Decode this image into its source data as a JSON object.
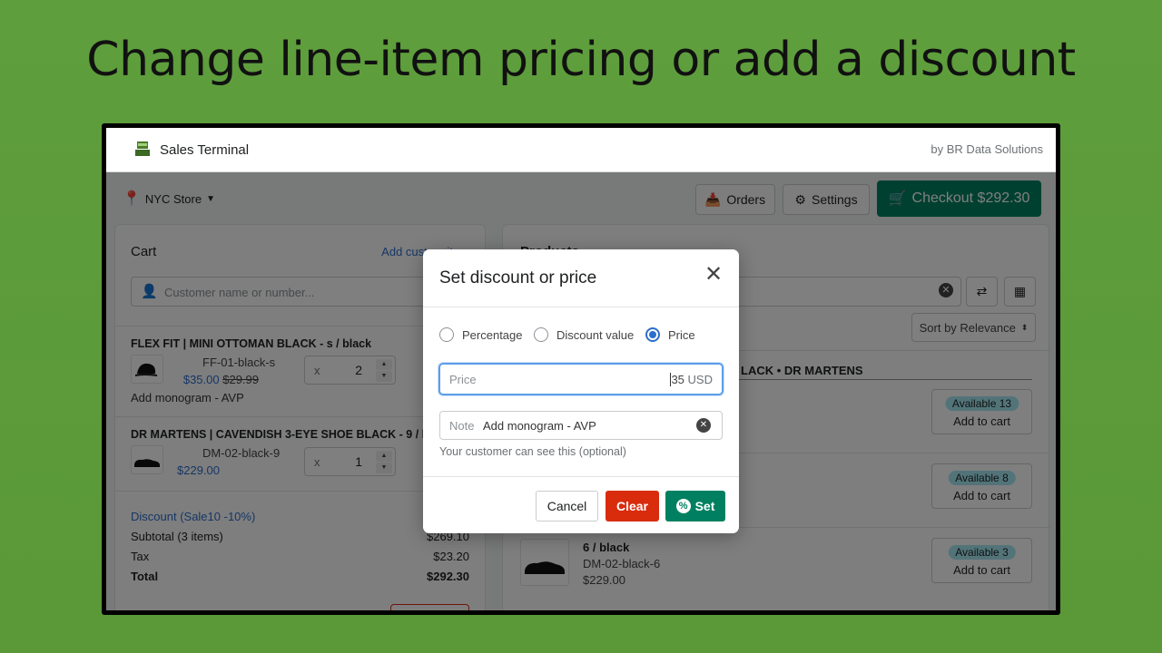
{
  "slide": {
    "title": "Change line-item pricing or add a discount"
  },
  "header": {
    "app_name": "Sales Terminal",
    "vendor": "by BR Data Solutions"
  },
  "toolbar": {
    "store": "NYC Store",
    "orders": "Orders",
    "settings": "Settings",
    "checkout": "Checkout $292.30"
  },
  "cart": {
    "title": "Cart",
    "add_custom_item": "Add custom item",
    "customer_placeholder": "Customer name or number...",
    "items": [
      {
        "title": "FLEX FIT | MINI OTTOMAN BLACK - s / black",
        "sku": "FF-01-black-s",
        "price": "$35.00",
        "original_price": "$29.99",
        "qty": "2",
        "note": "Add monogram - AVP",
        "qty_prefix": "x"
      },
      {
        "title": "DR MARTENS | CAVENDISH 3-EYE SHOE BLACK - 9 / black",
        "sku": "DM-02-black-9",
        "price": "$229.00",
        "qty": "1",
        "qty_prefix": "x"
      }
    ],
    "discount": "Discount (Sale10 -10%)",
    "subtotal_label": "Subtotal (3 items)",
    "subtotal": "$269.10",
    "tax_label": "Tax",
    "tax": "$23.20",
    "total_label": "Total",
    "total": "$292.30"
  },
  "products": {
    "title": "Products",
    "sort": "Sort by Relevance",
    "group_heading": "LACK • DR MARTENS",
    "variants": [
      {
        "availability": "Available 13",
        "add": "Add to cart"
      },
      {
        "availability": "Available 8",
        "add": "Add to cart"
      },
      {
        "title": "6 / black",
        "sku": "DM-02-black-6",
        "price": "$229.00",
        "availability": "Available 3",
        "add": "Add to cart"
      }
    ]
  },
  "modal": {
    "title": "Set discount or price",
    "options": [
      {
        "label": "Percentage",
        "selected": false
      },
      {
        "label": "Discount value",
        "selected": false
      },
      {
        "label": "Price",
        "selected": true
      }
    ],
    "price_label": "Price",
    "price_value": "35",
    "currency": "USD",
    "note_label": "Note",
    "note_value": "Add monogram - AVP",
    "note_help": "Your customer can see this (optional)",
    "cancel": "Cancel",
    "clear": "Clear",
    "set": "Set"
  },
  "colors": {
    "accent": "#008060",
    "danger": "#d82c0d",
    "link": "#2c6ecb",
    "background": "#5f9e3c"
  }
}
